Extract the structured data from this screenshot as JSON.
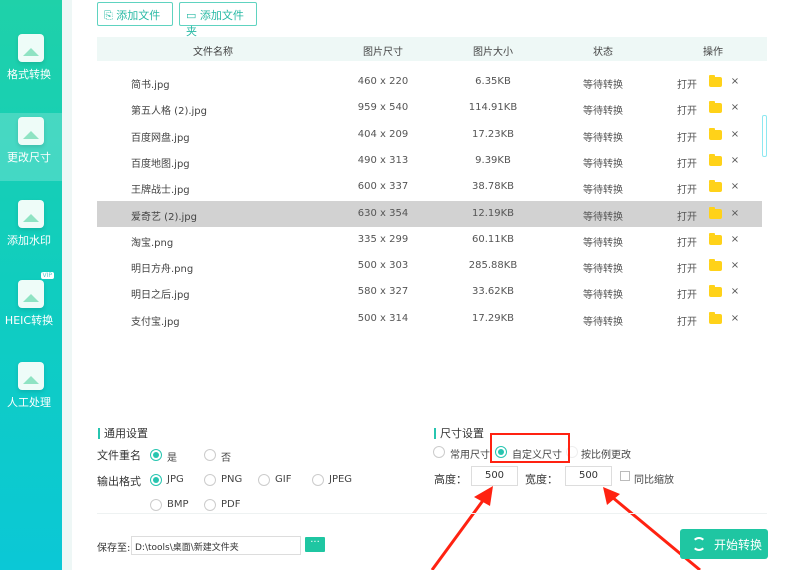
{
  "sidebar": {
    "items": [
      {
        "label": "格式转换"
      },
      {
        "label": "更改尺寸"
      },
      {
        "label": "添加水印"
      },
      {
        "label": "HEIC转换",
        "badge": "VIP"
      },
      {
        "label": "人工处理"
      }
    ]
  },
  "toolbar": {
    "add_file": "添加文件",
    "add_folder": "添加文件夹"
  },
  "table": {
    "headers": [
      "文件名称",
      "图片尺寸",
      "图片大小",
      "状态",
      "操作"
    ],
    "rows": [
      {
        "name": "简书.jpg",
        "dims": "460 x 220",
        "size": "6.35KB",
        "status": "等待转换",
        "open": "打开"
      },
      {
        "name": "第五人格 (2).jpg",
        "dims": "959 x 540",
        "size": "114.91KB",
        "status": "等待转换",
        "open": "打开"
      },
      {
        "name": "百度网盘.jpg",
        "dims": "404 x 209",
        "size": "17.23KB",
        "status": "等待转换",
        "open": "打开"
      },
      {
        "name": "百度地图.jpg",
        "dims": "490 x 313",
        "size": "9.39KB",
        "status": "等待转换",
        "open": "打开"
      },
      {
        "name": "王牌战士.jpg",
        "dims": "600 x 337",
        "size": "38.78KB",
        "status": "等待转换",
        "open": "打开"
      },
      {
        "name": "爱奇艺 (2).jpg",
        "dims": "630 x 354",
        "size": "12.19KB",
        "status": "等待转换",
        "open": "打开"
      },
      {
        "name": "淘宝.png",
        "dims": "335 x 299",
        "size": "60.11KB",
        "status": "等待转换",
        "open": "打开"
      },
      {
        "name": "明日方舟.png",
        "dims": "500 x 303",
        "size": "285.88KB",
        "status": "等待转换",
        "open": "打开"
      },
      {
        "name": "明日之后.jpg",
        "dims": "580 x 327",
        "size": "33.62KB",
        "status": "等待转换",
        "open": "打开"
      },
      {
        "name": "支付宝.jpg",
        "dims": "500 x 314",
        "size": "17.29KB",
        "status": "等待转换",
        "open": "打开"
      }
    ]
  },
  "general": {
    "title": "通用设置",
    "rename_label": "文件重名",
    "rename_yes": "是",
    "rename_no": "否",
    "format_label": "输出格式",
    "formats": [
      "JPG",
      "PNG",
      "GIF",
      "JPEG",
      "BMP",
      "PDF"
    ],
    "selected_format": "JPG"
  },
  "size": {
    "title": "尺寸设置",
    "modes": [
      "常用尺寸",
      "自定义尺寸",
      "按比例更改"
    ],
    "selected_mode": "自定义尺寸",
    "height_label": "高度：",
    "height": "500",
    "width_label": "宽度：",
    "width": "500",
    "proportional": "同比缩放"
  },
  "save": {
    "label": "保存至:",
    "path": "D:\\tools\\桌面\\新建文件夹",
    "browse": "···"
  },
  "start_button": "开始转换",
  "colors": {
    "accent": "#1fc6a2",
    "annotation": "#ff2211"
  }
}
